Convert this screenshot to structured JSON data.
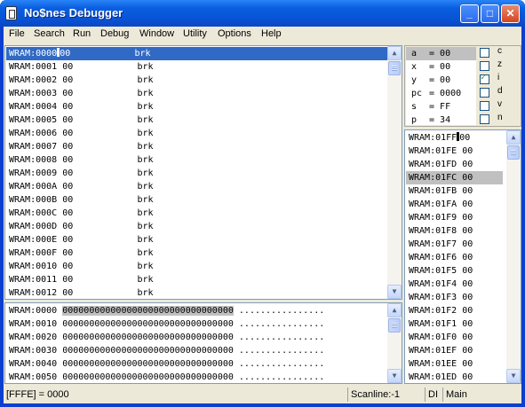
{
  "window": {
    "title": "No$nes Debugger",
    "min": "_",
    "max": "□",
    "close": "✕"
  },
  "menu": [
    "File",
    "Search",
    "Run",
    "Debug",
    "Window",
    "Utility",
    "Options",
    "Help"
  ],
  "disasm": [
    {
      "addr": "WRAM:0000",
      "byte": "00",
      "op": "brk"
    },
    {
      "addr": "WRAM:0001",
      "byte": "00",
      "op": "brk"
    },
    {
      "addr": "WRAM:0002",
      "byte": "00",
      "op": "brk"
    },
    {
      "addr": "WRAM:0003",
      "byte": "00",
      "op": "brk"
    },
    {
      "addr": "WRAM:0004",
      "byte": "00",
      "op": "brk"
    },
    {
      "addr": "WRAM:0005",
      "byte": "00",
      "op": "brk"
    },
    {
      "addr": "WRAM:0006",
      "byte": "00",
      "op": "brk"
    },
    {
      "addr": "WRAM:0007",
      "byte": "00",
      "op": "brk"
    },
    {
      "addr": "WRAM:0008",
      "byte": "00",
      "op": "brk"
    },
    {
      "addr": "WRAM:0009",
      "byte": "00",
      "op": "brk"
    },
    {
      "addr": "WRAM:000A",
      "byte": "00",
      "op": "brk"
    },
    {
      "addr": "WRAM:000B",
      "byte": "00",
      "op": "brk"
    },
    {
      "addr": "WRAM:000C",
      "byte": "00",
      "op": "brk"
    },
    {
      "addr": "WRAM:000D",
      "byte": "00",
      "op": "brk"
    },
    {
      "addr": "WRAM:000E",
      "byte": "00",
      "op": "brk"
    },
    {
      "addr": "WRAM:000F",
      "byte": "00",
      "op": "brk"
    },
    {
      "addr": "WRAM:0010",
      "byte": "00",
      "op": "brk"
    },
    {
      "addr": "WRAM:0011",
      "byte": "00",
      "op": "brk"
    },
    {
      "addr": "WRAM:0012",
      "byte": "00",
      "op": "brk"
    }
  ],
  "hexdump": [
    {
      "addr": "WRAM:0000",
      "hex": "00000000000000000000000000000000",
      "ascii": "................"
    },
    {
      "addr": "WRAM:0010",
      "hex": "00000000000000000000000000000000",
      "ascii": "................"
    },
    {
      "addr": "WRAM:0020",
      "hex": "00000000000000000000000000000000",
      "ascii": "................"
    },
    {
      "addr": "WRAM:0030",
      "hex": "00000000000000000000000000000000",
      "ascii": "................"
    },
    {
      "addr": "WRAM:0040",
      "hex": "00000000000000000000000000000000",
      "ascii": "................"
    },
    {
      "addr": "WRAM:0050",
      "hex": "00000000000000000000000000000000",
      "ascii": "................"
    }
  ],
  "registers": [
    {
      "name": "a",
      "value": "00"
    },
    {
      "name": "x",
      "value": "00"
    },
    {
      "name": "y",
      "value": "00"
    },
    {
      "name": "pc",
      "value": "0000"
    },
    {
      "name": "s",
      "value": "FF"
    },
    {
      "name": "p",
      "value": "34"
    }
  ],
  "flags": [
    {
      "name": "c",
      "checked": false
    },
    {
      "name": "z",
      "checked": false
    },
    {
      "name": "i",
      "checked": true
    },
    {
      "name": "d",
      "checked": false
    },
    {
      "name": "v",
      "checked": false
    },
    {
      "name": "n",
      "checked": false
    }
  ],
  "stack": [
    {
      "addr": "WRAM:01FF",
      "val": "00"
    },
    {
      "addr": "WRAM:01FE",
      "val": "00"
    },
    {
      "addr": "WRAM:01FD",
      "val": "00"
    },
    {
      "addr": "WRAM:01FC",
      "val": "00"
    },
    {
      "addr": "WRAM:01FB",
      "val": "00"
    },
    {
      "addr": "WRAM:01FA",
      "val": "00"
    },
    {
      "addr": "WRAM:01F9",
      "val": "00"
    },
    {
      "addr": "WRAM:01F8",
      "val": "00"
    },
    {
      "addr": "WRAM:01F7",
      "val": "00"
    },
    {
      "addr": "WRAM:01F6",
      "val": "00"
    },
    {
      "addr": "WRAM:01F5",
      "val": "00"
    },
    {
      "addr": "WRAM:01F4",
      "val": "00"
    },
    {
      "addr": "WRAM:01F3",
      "val": "00"
    },
    {
      "addr": "WRAM:01F2",
      "val": "00"
    },
    {
      "addr": "WRAM:01F1",
      "val": "00"
    },
    {
      "addr": "WRAM:01F0",
      "val": "00"
    },
    {
      "addr": "WRAM:01EF",
      "val": "00"
    },
    {
      "addr": "WRAM:01EE",
      "val": "00"
    },
    {
      "addr": "WRAM:01ED",
      "val": "00"
    }
  ],
  "status": {
    "address": "[FFFE] = 0000",
    "scanline": "Scanline:-1",
    "di": "DI",
    "main": "Main"
  }
}
